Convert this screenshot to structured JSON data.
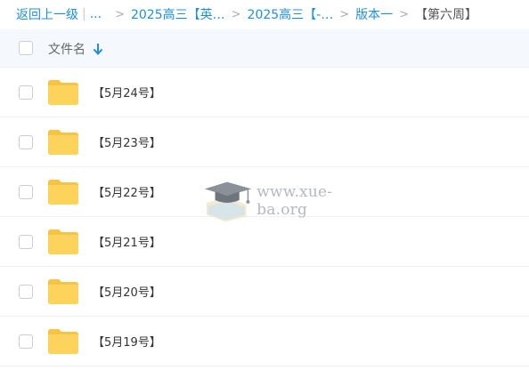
{
  "breadcrumb": {
    "back": "返回上一级",
    "pipe": "|",
    "ellipsis": "...",
    "separator": ">",
    "items": [
      "2025高三【英…",
      "2025高三【-…",
      "版本一"
    ],
    "current": "【第六周】"
  },
  "header": {
    "column_name": "文件名",
    "sort_icon": "arrow-down-icon"
  },
  "files": [
    {
      "name": "【5月24号】",
      "icon": "folder-icon"
    },
    {
      "name": "【5月23号】",
      "icon": "folder-icon"
    },
    {
      "name": "【5月22号】",
      "icon": "folder-icon"
    },
    {
      "name": "【5月21号】",
      "icon": "folder-icon"
    },
    {
      "name": "【5月20号】",
      "icon": "folder-icon"
    },
    {
      "name": "【5月19号】",
      "icon": "folder-icon"
    }
  ],
  "watermark": {
    "text": "www.xue-ba.org"
  },
  "colors": {
    "link": "#1d8fe0",
    "folder": "#fdd35c",
    "header_bg": "#f5f8fc"
  }
}
